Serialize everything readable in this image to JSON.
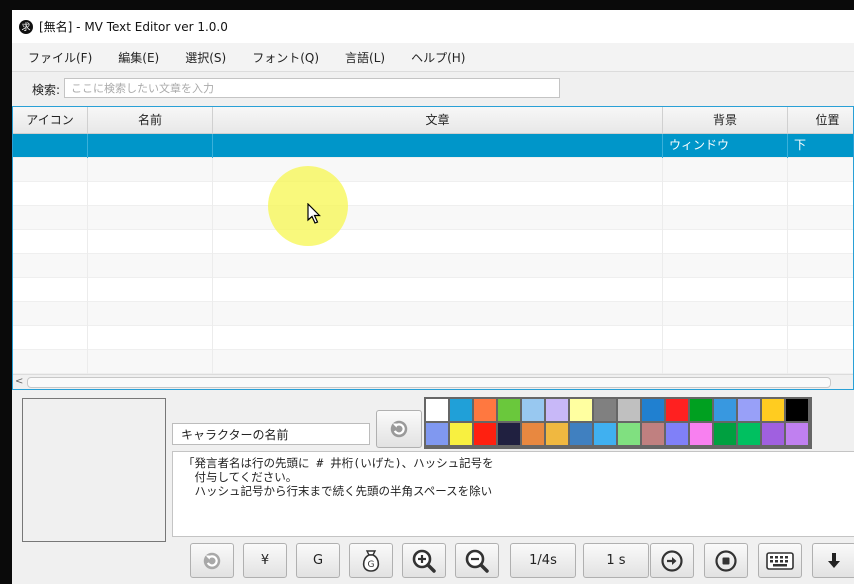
{
  "window": {
    "app_icon_glyph": "求",
    "title": "[無名] - MV Text Editor ver 1.0.0"
  },
  "menu": {
    "items": [
      "ファイル(F)",
      "編集(E)",
      "選択(S)",
      "フォント(Q)",
      "言語(L)",
      "ヘルプ(H)"
    ]
  },
  "search": {
    "label": "検索:",
    "placeholder": "ここに検索したい文章を入力",
    "value": ""
  },
  "table": {
    "columns": [
      "アイコン",
      "名前",
      "文章",
      "背景",
      "位置"
    ],
    "rows": [
      {
        "icon": "",
        "name": "",
        "text": "",
        "background": "ウィンドウ",
        "position": "下",
        "selected": true
      }
    ]
  },
  "editor": {
    "name_value": "キャラクターの名前",
    "message_text": "「発言者名は行の先頭に # 井桁(いげた)、ハッシュ記号を\n　付与してください。\n　ハッシュ記号から行末まで続く先頭の半角スペースを除い",
    "palette": {
      "row1": [
        "#ffffff",
        "#20a0d8",
        "#ff7840",
        "#6ac83c",
        "#98c8f0",
        "#c8b8f8",
        "#ffffa0",
        "#808080",
        "#c0c0c0",
        "#2080d0",
        "#ff2020",
        "#00a020",
        "#3898e0",
        "#98a0f8",
        "#ffcc20",
        "#000000"
      ],
      "row2": [
        "#8098f0",
        "#f8f040",
        "#ff2010",
        "#202040",
        "#e88840",
        "#f0b840",
        "#4080c0",
        "#40b0f0",
        "#80e080",
        "#c08080",
        "#8080f8",
        "#f880f0",
        "#00a040",
        "#00c060",
        "#a060e0",
        "#c080f0"
      ]
    }
  },
  "toolbar": {
    "buttons": [
      {
        "name": "undo-button",
        "icon": "undo-icon",
        "label": ""
      },
      {
        "name": "yen-button",
        "icon": "",
        "label": "¥"
      },
      {
        "name": "gold-button",
        "icon": "",
        "label": "G"
      },
      {
        "name": "money-bag-button",
        "icon": "money-bag-icon",
        "label": ""
      },
      {
        "name": "zoom-in-button",
        "icon": "zoom-in-icon",
        "label": ""
      },
      {
        "name": "zoom-out-button",
        "icon": "zoom-out-icon",
        "label": ""
      },
      {
        "name": "quarter-second-wait-button",
        "icon": "",
        "label": "1/4s"
      },
      {
        "name": "one-second-wait-button",
        "icon": "",
        "label": "1 s"
      },
      {
        "name": "arrow-right-button",
        "icon": "arrow-right-circle-icon",
        "label": ""
      },
      {
        "name": "stop-button",
        "icon": "stop-circle-icon",
        "label": ""
      },
      {
        "name": "keyboard-button",
        "icon": "keyboard-icon",
        "label": ""
      },
      {
        "name": "down-arrow-button",
        "icon": "arrow-down-icon",
        "label": ""
      }
    ]
  },
  "colors": {
    "selection": "#0096c9",
    "table_border": "#29a0d6",
    "cursor_highlight": "#f7f750"
  }
}
